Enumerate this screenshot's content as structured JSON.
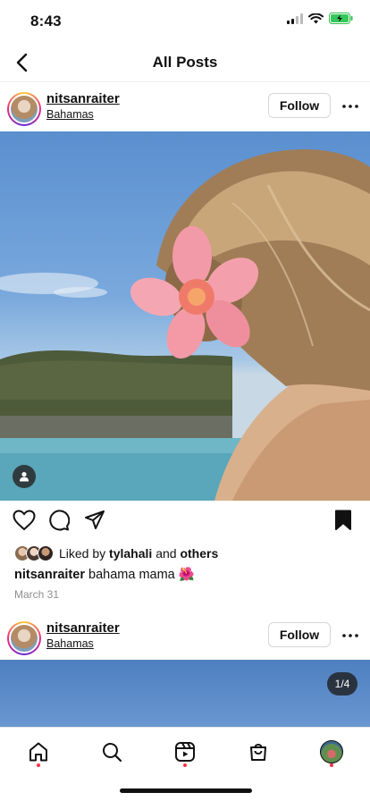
{
  "status": {
    "time": "8:43"
  },
  "header": {
    "title": "All Posts"
  },
  "posts": [
    {
      "username": "nitsanraiter",
      "location": "Bahamas",
      "follow_label": "Follow",
      "liked_prefix": "Liked by",
      "liked_user": "tylahali",
      "liked_and": "and",
      "liked_others": "others",
      "caption_user": "nitsanraiter",
      "caption_text": "bahama mama 🌺",
      "date": "March 31"
    },
    {
      "username": "nitsanraiter",
      "location": "Bahamas",
      "follow_label": "Follow",
      "media_counter": "1/4"
    }
  ],
  "icons": {
    "back": "chevron-left-icon",
    "more": "more-horizontal-icon",
    "like": "heart-icon",
    "comment": "comment-icon",
    "share": "send-icon",
    "save": "bookmark-icon",
    "tag": "user-tag-icon"
  },
  "nav": [
    "home",
    "search",
    "reels",
    "shop",
    "profile"
  ],
  "colors": {
    "notification_dot": "#ff3040",
    "text": "#111111",
    "muted": "#8e8e8e"
  }
}
